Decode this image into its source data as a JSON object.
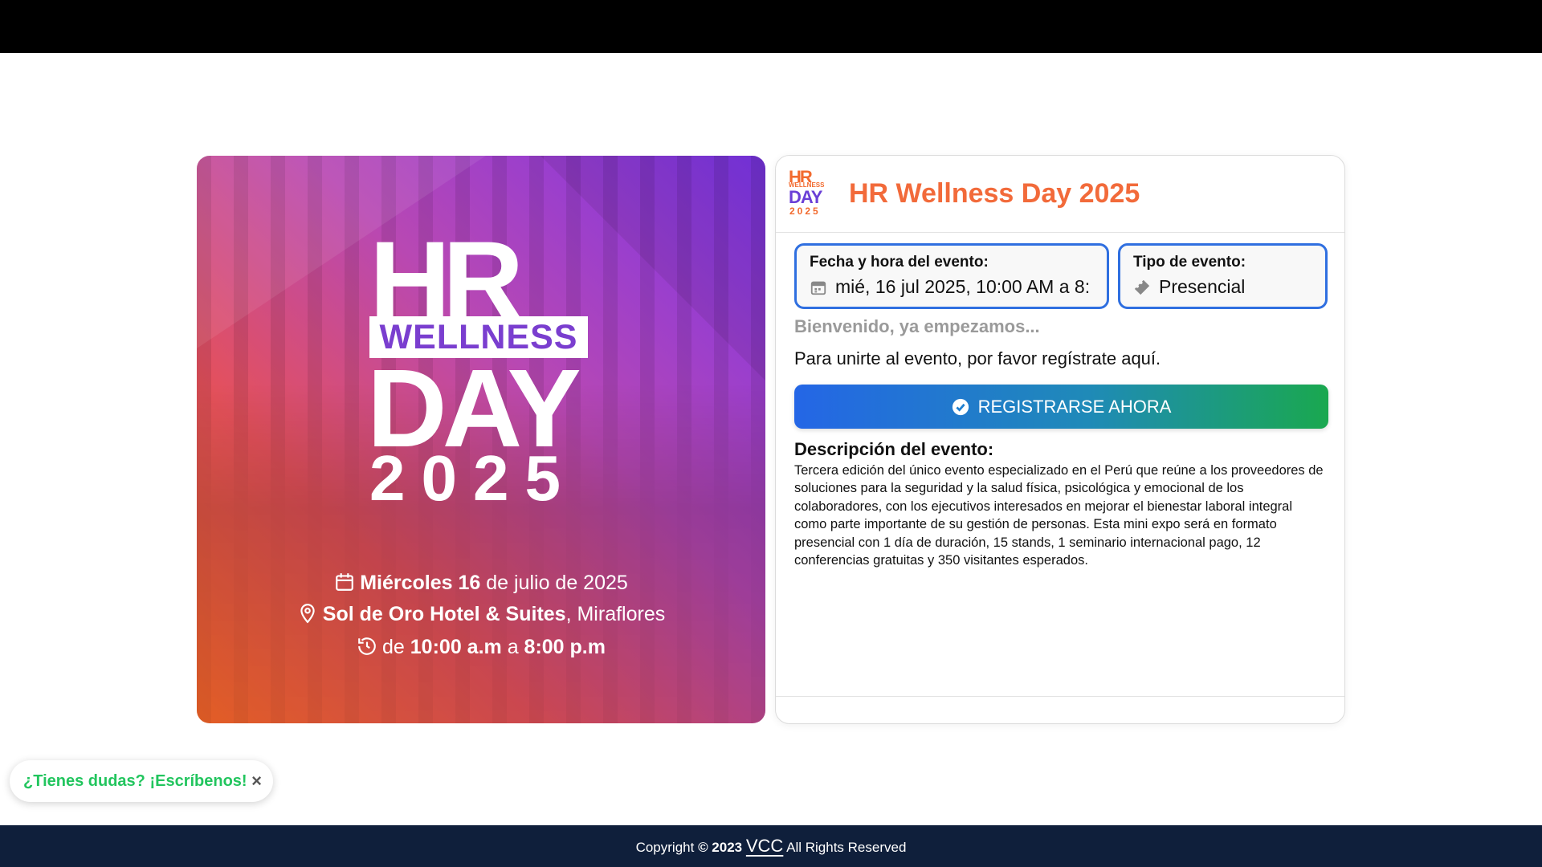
{
  "banner": {
    "logo": {
      "hr": "HR",
      "wellness": "WELLNESS",
      "day": "DAY",
      "year": "2025"
    },
    "date": {
      "day_bold": "Miércoles 16",
      "rest": " de julio de 2025"
    },
    "place": {
      "bold": "Sol de Oro Hotel & Suites",
      "rest": ", Miraflores"
    },
    "time": {
      "pre": "de ",
      "start": "10:00 a.m",
      "mid": " a ",
      "end": "8:00 p.m"
    },
    "icons": [
      "calendar-icon",
      "location-pin-icon",
      "clock-history-icon"
    ]
  },
  "card": {
    "small_logo": {
      "hr": "HR",
      "wellness": "WELLNESS",
      "day": "DAY",
      "year": "2025"
    },
    "title": "HR Wellness Day 2025",
    "date_field": {
      "label": "Fecha y hora del evento:",
      "value": "mié, 16 jul 2025, 10:00 AM a 8:"
    },
    "type_field": {
      "label": "Tipo de evento:",
      "value": "Presencial"
    },
    "welcome": "Bienvenido, ya empezamos...",
    "join_text": "Para unirte al evento, por favor regístrate aquí.",
    "register_button": "REGISTRARSE AHORA",
    "description_title": "Descripción del evento:",
    "description": "Tercera edición del único evento especializado en el Perú que reúne a los proveedores de soluciones para la seguridad y la salud física, psicológica y emocional de los colaboradores, con los ejecutivos interesados en mejorar el bienestar laboral integral como parte importante de su gestión de personas. Esta mini expo será en formato presencial con 1 día de duración, 15 stands, 1 seminario internacional pago, 12 conferencias gratuitas y 350 visitantes esperados."
  },
  "chat": {
    "text": "¿Tienes dudas? ¡Escríbenos!",
    "close": "×"
  },
  "footer": {
    "copyright": "Copyright ",
    "year": "© 2023",
    "brand": "VCC",
    "rights": " All Rights Reserved"
  },
  "colors": {
    "accent_orange": "#f26a3a",
    "accent_blue": "#2f6fe0",
    "accent_green": "#22c55e",
    "footer_bg": "#0f1f3b"
  }
}
